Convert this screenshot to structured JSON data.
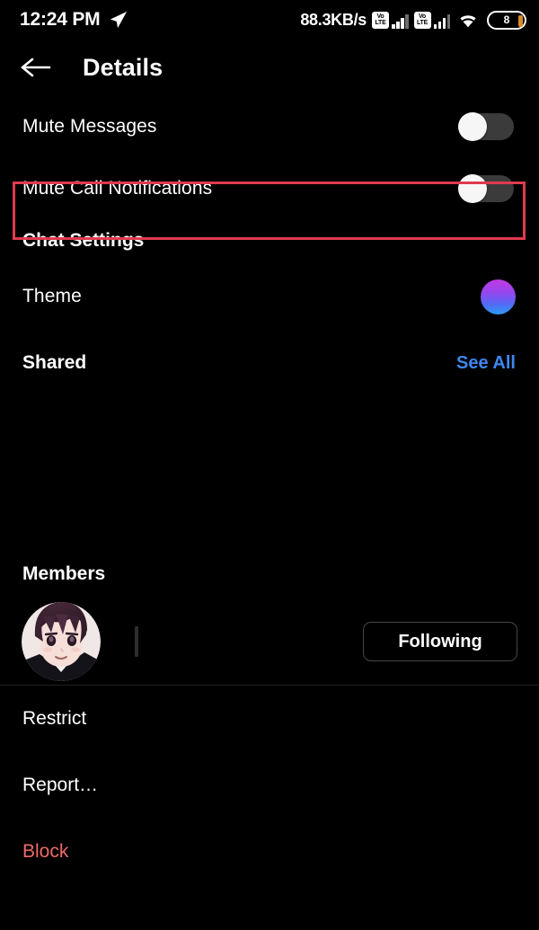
{
  "status_bar": {
    "time": "12:24 PM",
    "send_icon": "send-icon",
    "network_speed": "88.3KB/s",
    "volte_label_top": "Vo",
    "volte_label_bottom": "LTE",
    "sim_count": 2,
    "wifi_icon": "wifi-icon",
    "battery_level": "8"
  },
  "header": {
    "back_icon": "back-arrow-icon",
    "title": "Details"
  },
  "notifications": {
    "mute_messages": {
      "label": "Mute Messages",
      "state": "off"
    },
    "mute_call_notifications": {
      "label": "Mute Call Notifications",
      "state": "off"
    }
  },
  "highlight": {
    "color": "#e03a4e"
  },
  "chat_settings": {
    "heading": "Chat Settings",
    "theme": {
      "label": "Theme",
      "swatch_from": "#c13ae0",
      "swatch_to": "#2f9cf7"
    }
  },
  "shared": {
    "heading": "Shared",
    "see_all": "See All",
    "link_color": "#3f86ef"
  },
  "members": {
    "heading": "Members",
    "list": [
      {
        "avatar": "anime-avatar",
        "username": "",
        "action_label": "Following"
      }
    ]
  },
  "actions": [
    {
      "label": "Restrict",
      "danger": false
    },
    {
      "label": "Report…",
      "danger": false
    },
    {
      "label": "Block",
      "danger": true,
      "color": "#ed6a6a"
    }
  ]
}
